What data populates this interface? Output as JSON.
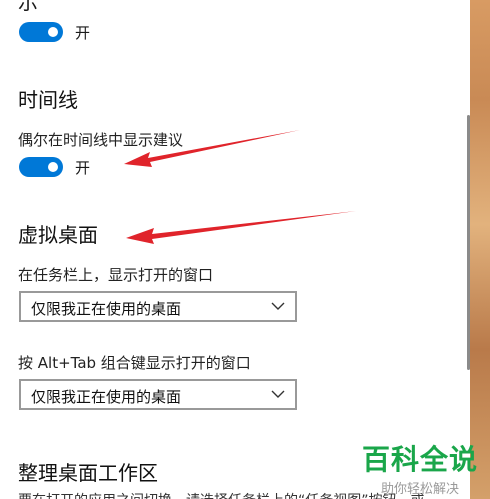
{
  "top_partial": {
    "text": "示"
  },
  "timeline": {
    "title": "时间线",
    "setting_label": "偶尔在时间线中显示建议",
    "toggle_state": "开"
  },
  "toggle_top": {
    "state": "开"
  },
  "virtual_desktops": {
    "title": "虚拟桌面",
    "taskbar_label": "在任务栏上，显示打开的窗口",
    "taskbar_value": "仅限我正在使用的桌面",
    "alttab_label": "按 Alt+Tab 组合键显示打开的窗口",
    "alttab_value": "仅限我正在使用的桌面"
  },
  "snap": {
    "title": "整理桌面工作区",
    "desc_partial": "要在打开的应用之间切换，请选择任务栏上的“任务视图”按钮，或"
  },
  "watermark": {
    "main": "百科全说",
    "sub": "助你轻松解决"
  },
  "colors": {
    "toggle_on": "#0078d7",
    "arrow_red": "#e0242b",
    "watermark_green": "#1aa64a"
  }
}
